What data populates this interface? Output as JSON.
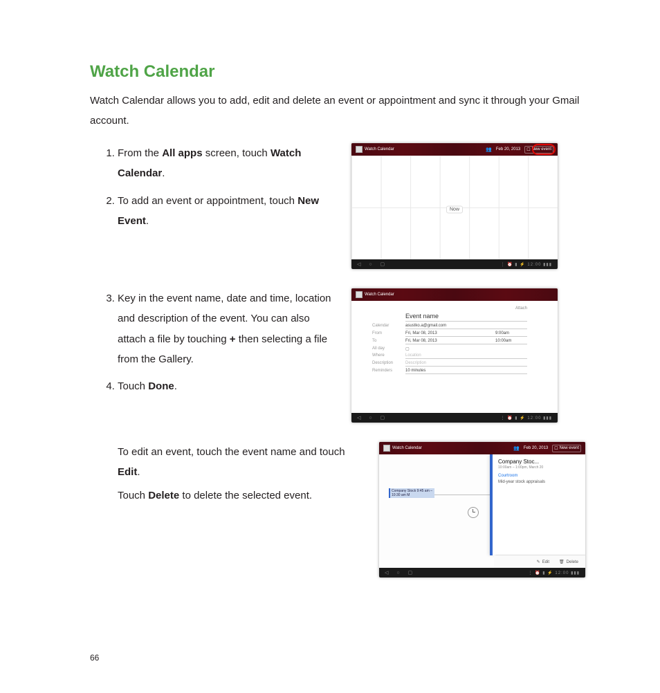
{
  "page_number": "66",
  "heading": "Watch Calendar",
  "intro": "Watch Calendar allows you to add, edit and delete an event or appointment and sync it through your Gmail account.",
  "steps": {
    "s1": {
      "pre": "From the ",
      "b1": "All apps",
      "mid": " screen, touch ",
      "b2": "Watch Calendar",
      "post": "."
    },
    "s2": {
      "pre": "To add an event or appointment, touch ",
      "b1": "New Event",
      "post": "."
    },
    "s3": {
      "pre": "Key in the event name, date and time, location and description of the event. You can also attach a file by touching ",
      "b1": "+",
      "post": " then selecting a file from the Gallery."
    },
    "s4": {
      "pre": "Touch ",
      "b1": "Done",
      "post": "."
    }
  },
  "edit_note": {
    "line1": {
      "pre": "To edit an event, touch the event name and touch ",
      "b1": "Edit",
      "post": "."
    },
    "line2": {
      "pre": "Touch ",
      "b1": "Delete",
      "post": " to delete the selected event."
    }
  },
  "screens": {
    "app_title": "Watch Calendar",
    "date": "Feb 20, 2013",
    "new_event": "New event",
    "now_label": "Now",
    "form": {
      "event_name": "Event name",
      "attach": "Attach",
      "calendar_lbl": "Calendar",
      "calendar_val": "asustko.a@gmail.com",
      "from_lbl": "From",
      "from_date": "Fri, Mar 08, 2013",
      "from_time": "9:00am",
      "to_lbl": "To",
      "to_date": "Fri, Mar 08, 2013",
      "to_time": "10:00am",
      "allday_lbl": "All day",
      "where_lbl": "Where",
      "where_ph": "Location",
      "desc_lbl": "Description",
      "desc_ph": "Description",
      "rem_lbl": "Reminders",
      "rem_val": "10 minutes"
    },
    "event": {
      "title": "Company Stoc...",
      "chip": "Company Stock\n9:45 am – 10:30 am  M",
      "subtitle": "10:00am – 1:00pm, March 20",
      "location": "Courtroom",
      "description": "Mid-year stock appraisals",
      "edit": "Edit",
      "delete": "Delete"
    },
    "nav": {
      "back": "◁",
      "home": "○",
      "recent": "▢",
      "status": "⋮ ⏰ ▮ ⚡ 12:00 ▮▮▮"
    }
  }
}
